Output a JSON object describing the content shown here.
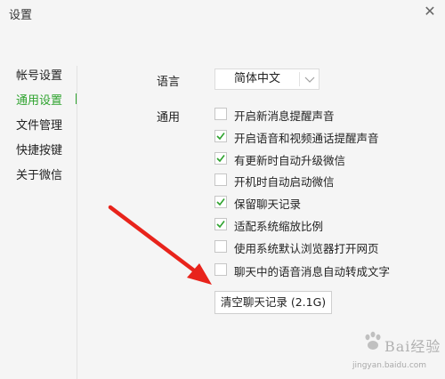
{
  "window": {
    "title": "设置",
    "close_symbol": "✕"
  },
  "sidebar": {
    "items": [
      {
        "label": "帐号设置",
        "active": false
      },
      {
        "label": "通用设置",
        "active": true
      },
      {
        "label": "文件管理",
        "active": false
      },
      {
        "label": "快捷按键",
        "active": false
      },
      {
        "label": "关于微信",
        "active": false
      }
    ]
  },
  "language": {
    "label": "语言",
    "selected": "简体中文"
  },
  "general": {
    "label": "通用",
    "options": [
      {
        "label": "开启新消息提醒声音",
        "checked": false
      },
      {
        "label": "开启语音和视频通话提醒声音",
        "checked": true
      },
      {
        "label": "有更新时自动升级微信",
        "checked": true
      },
      {
        "label": "开机时自动启动微信",
        "checked": false
      },
      {
        "label": "保留聊天记录",
        "checked": true
      },
      {
        "label": "适配系统缩放比例",
        "checked": true
      },
      {
        "label": "使用系统默认浏览器打开网页",
        "checked": false
      },
      {
        "label": "聊天中的语音消息自动转成文字",
        "checked": false
      }
    ],
    "clear_button": "清空聊天记录 (2.1G)"
  },
  "watermark": {
    "text": "Bai经验",
    "url": "jingyan.baidu.com"
  },
  "colors": {
    "accent": "#2ea32e",
    "arrow": "#e8231b",
    "background": "#f5f5f5"
  }
}
